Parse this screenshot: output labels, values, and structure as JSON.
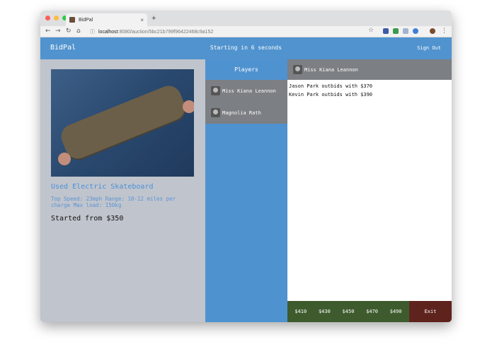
{
  "browser": {
    "tab_title": "BidPal",
    "tab_close": "×",
    "new_tab": "+",
    "url_host": "localhost",
    "url_path": ":8080/auction/5bc21b799f96422468c9a152"
  },
  "app": {
    "brand": "BidPal",
    "countdown": "Starting in 6 seconds",
    "sign_out": "Sign Out"
  },
  "item": {
    "title": "Used Electric Skateboard",
    "description": "Top Speed: 23mph Range: 10-12 miles per charge Max load: 150kg",
    "price": "Started from $350"
  },
  "players": {
    "heading": "Players",
    "list": [
      "Miss Kiana Leannon",
      "Magnolia Rath"
    ]
  },
  "chat": {
    "current_player": "Miss Kiana Leannon",
    "messages": [
      "Jason Park outbids with $370",
      "Kevin Park outbids with $390"
    ]
  },
  "bids": [
    "$410",
    "$430",
    "$450",
    "$470",
    "$490"
  ],
  "exit_label": "Exit",
  "colors": {
    "primary": "#5193ce",
    "panel_gray": "#7c7f83",
    "bid_bar": "#3e5b2d",
    "exit": "#5f231e"
  }
}
